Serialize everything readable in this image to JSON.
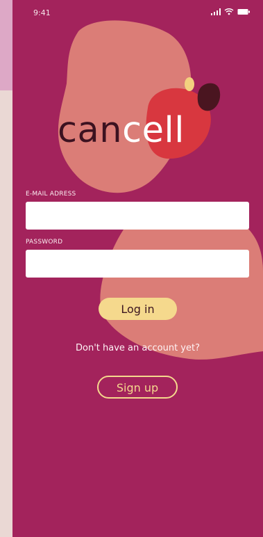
{
  "status_bar": {
    "time": "9:41",
    "signal_icon": "signal-bars-icon",
    "wifi_icon": "wifi-icon",
    "battery_icon": "battery-icon"
  },
  "logo": {
    "part1": "can",
    "part2": "cell"
  },
  "form": {
    "email_label": "E-MAIL ADRESS",
    "email_value": "",
    "password_label": "PASSWORD",
    "password_value": ""
  },
  "actions": {
    "login_label": "Log in",
    "no_account_text": "Don't have an account yet?",
    "signup_label": "Sign up"
  },
  "colors": {
    "background": "#a3235c",
    "accent_yellow": "#f5d98d",
    "blob_peach": "#e38a7b",
    "blob_red": "#d8373f",
    "text_dark": "#3c1220"
  }
}
